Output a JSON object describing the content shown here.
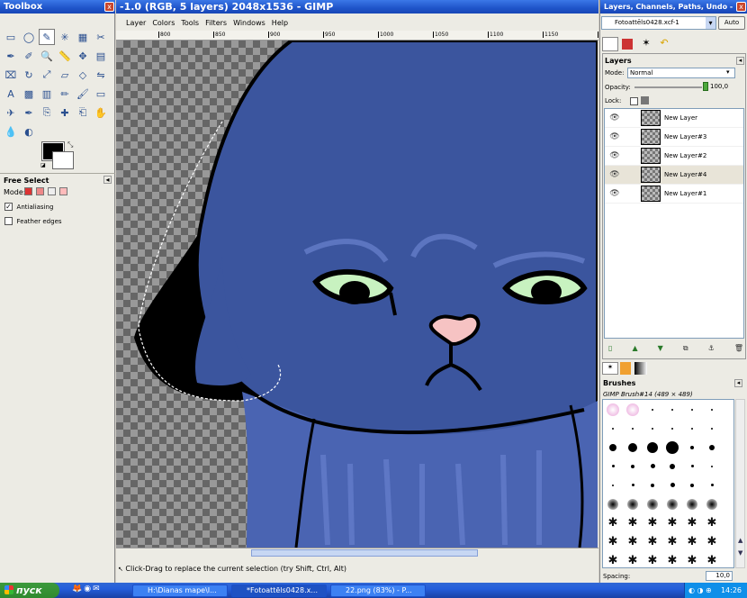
{
  "toolbox": {
    "title": "Toolbox",
    "close_label": "x",
    "tool_icons": [
      "rect-select-icon",
      "ellipse-select-icon",
      "free-select-icon",
      "fuzzy-select-icon",
      "select-by-color-icon",
      "scissors-icon",
      "paths-icon",
      "color-picker-icon",
      "zoom-icon",
      "measure-icon",
      "move-icon",
      "align-icon",
      "crop-icon",
      "rotate-icon",
      "scale-icon",
      "shear-icon",
      "perspective-icon",
      "flip-icon",
      "text-icon",
      "bucket-fill-icon",
      "blend-icon",
      "pencil-icon",
      "paintbrush-icon",
      "eraser-icon",
      "airbrush-icon",
      "ink-icon",
      "clone-icon",
      "heal-icon",
      "perspective-clone-icon",
      "smudge-icon",
      "blur-icon",
      "dodge-burn-icon"
    ],
    "tool_glyphs": [
      "▭",
      "◯",
      "✎",
      "✳",
      "▦",
      "✂",
      "✒",
      "✐",
      "🔍",
      "📏",
      "✥",
      "▤",
      "⌧",
      "↻",
      "⤢",
      "▱",
      "◇",
      "⇋",
      "A",
      "▩",
      "▥",
      "✏",
      "🖌",
      "▭",
      "✈",
      "✒",
      "⎘",
      "✚",
      "⎗",
      "✋",
      "💧",
      "◐"
    ],
    "options": {
      "title": "Free Select",
      "mode_label": "Mode:",
      "antialiasing_label": "Antialiasing",
      "antialiasing_checked": true,
      "feather_label": "Feather edges",
      "feather_checked": false
    }
  },
  "image_window": {
    "title": "-1.0 (RGB, 5 layers) 2048x1536 - GIMP",
    "menu": [
      "Layer",
      "Colors",
      "Tools",
      "Filters",
      "Windows",
      "Help"
    ],
    "ruler_ticks": [
      "800",
      "850",
      "900",
      "950",
      "1000",
      "1050",
      "1100",
      "1150",
      "1200"
    ],
    "status_text": "Click-Drag to replace the current selection (try Shift, Ctrl, Alt)"
  },
  "dock": {
    "title": "Layers, Channels, Paths, Undo -",
    "image_select": "Fotoattēls0428.xcf-1",
    "auto_label": "Auto",
    "layers_title": "Layers",
    "mode_label": "Mode:",
    "mode_value": "Normal",
    "opacity_label": "Opacity:",
    "opacity_value": "100,0",
    "lock_label": "Lock:",
    "layers": [
      {
        "name": "New Layer",
        "selected": false
      },
      {
        "name": "New Layer#3",
        "selected": false
      },
      {
        "name": "New Layer#2",
        "selected": false
      },
      {
        "name": "New Layer#4",
        "selected": true
      },
      {
        "name": "New Layer#1",
        "selected": false
      }
    ],
    "brushes_title": "Brushes",
    "brush_name": "GIMP Brush#14 (489 × 489)",
    "spacing_label": "Spacing:",
    "spacing_value": "10,0"
  },
  "taskbar": {
    "start_label": "пуск",
    "tasks": [
      {
        "label": "H:\\Dianas mape\\I...",
        "active": false
      },
      {
        "label": "*Fotoattēls0428.x...",
        "active": true
      },
      {
        "label": "22.png (83%) - P...",
        "active": false
      }
    ],
    "clock": "14:26"
  },
  "colors": {
    "cat_blue": "#3b559e",
    "eye_green": "#c8f2c0",
    "nose_pink": "#f6c3c3"
  }
}
